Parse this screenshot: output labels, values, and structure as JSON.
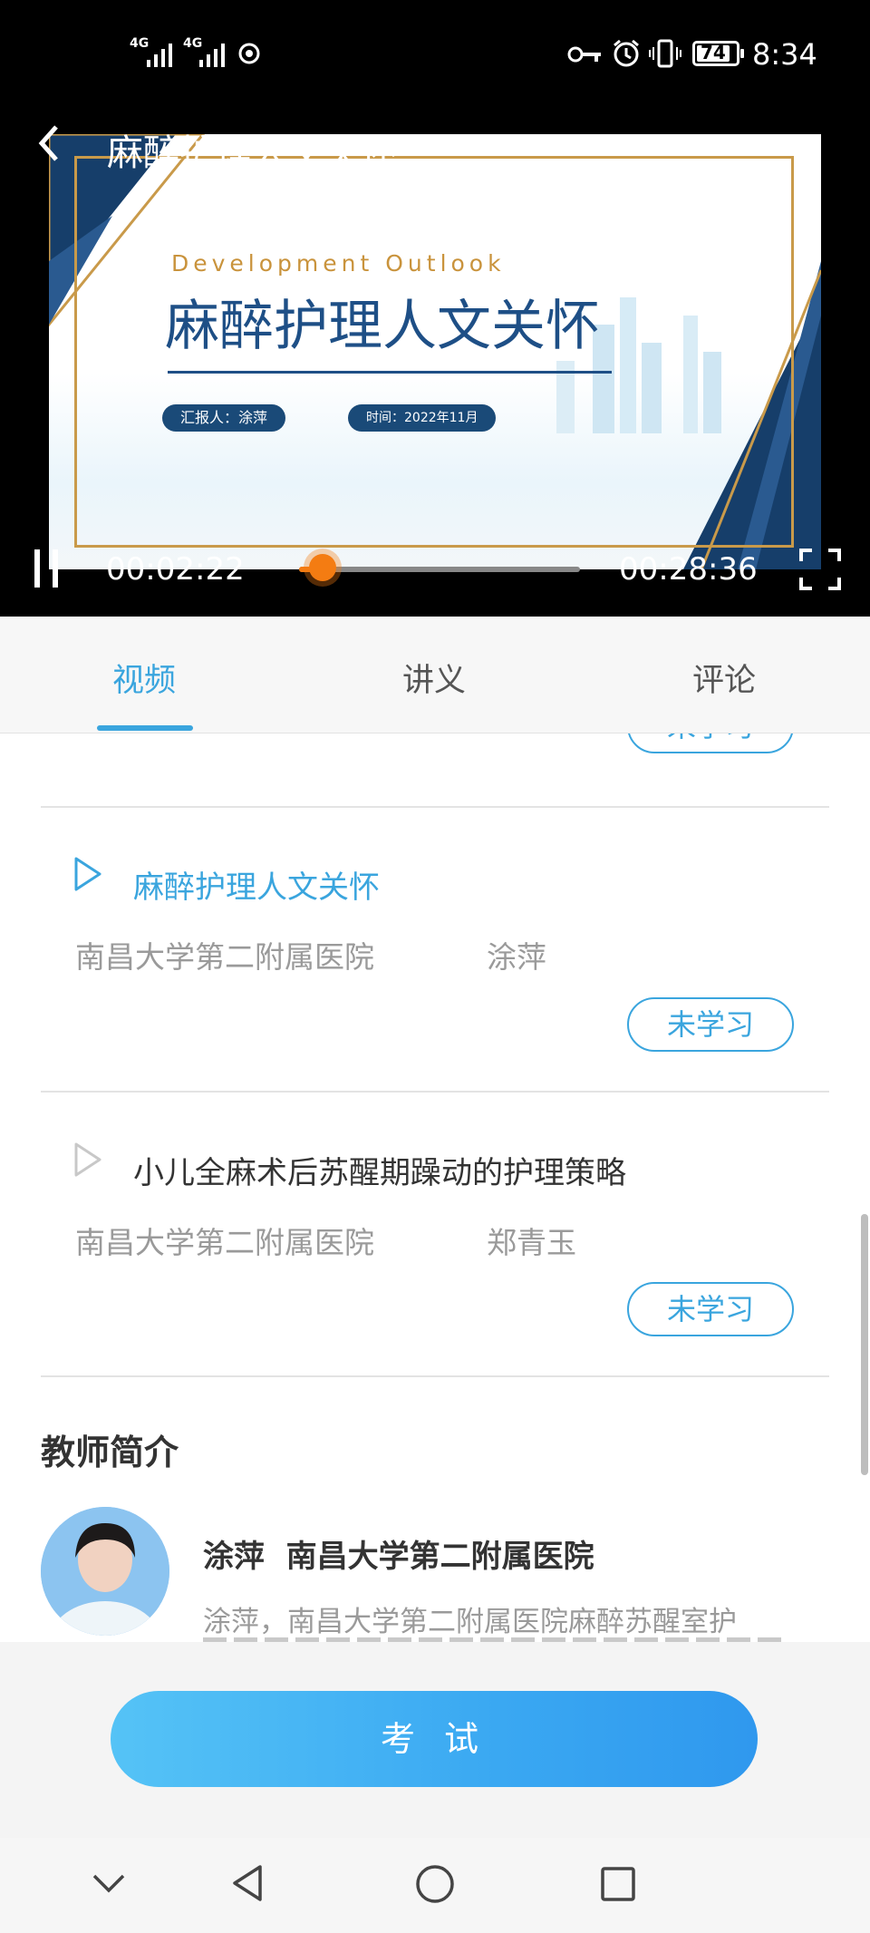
{
  "status_bar": {
    "signal1": "4G",
    "signal2": "4G",
    "battery": "74",
    "time": "8:34"
  },
  "player": {
    "title": "麻醉护理人文关怀",
    "slide": {
      "subtitle": "Development Outlook",
      "title": "麻醉护理人文关怀",
      "reporter": "汇报人：涂萍",
      "date": "时间：2022年11月"
    },
    "current_time": "00:02:22",
    "total_time": "00:28:36",
    "progress": 0.083
  },
  "tabs": [
    {
      "label": "视频",
      "active": true
    },
    {
      "label": "讲义",
      "active": false
    },
    {
      "label": "评论",
      "active": false
    }
  ],
  "lessons": [
    {
      "title": "麻醉护理人文关怀",
      "hospital": "南昌大学第二附属医院",
      "teacher": "涂萍",
      "status": "未学习",
      "playing": true
    },
    {
      "title": "小儿全麻术后苏醒期躁动的护理策略",
      "hospital": "南昌大学第二附属医院",
      "teacher": "郑青玉",
      "status": "未学习",
      "playing": false
    }
  ],
  "partial_status": "未学习",
  "teacher_intro": {
    "heading": "教师简介",
    "name_line": "涂萍  南昌大学第二附属医院",
    "bio": "涂萍，南昌大学第二附属医院麻醉苏醒室护"
  },
  "exam_button": "考 试",
  "colors": {
    "accent": "#3aa5de",
    "progress": "#f47c12"
  }
}
